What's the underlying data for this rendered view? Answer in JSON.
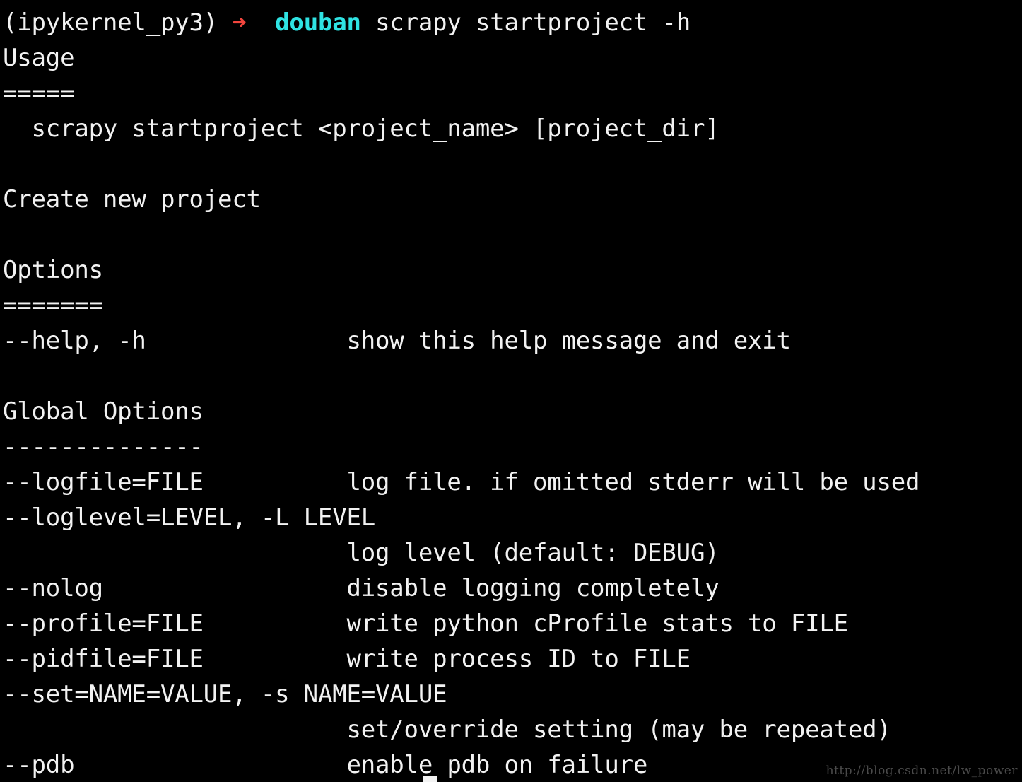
{
  "terminal": {
    "background": "#000000",
    "foreground": "#f2f2f2",
    "arrow_color": "#f2453d",
    "accent_color": "#2fe3e3",
    "watermark_color": "#4a4a4a"
  },
  "prompt": {
    "env": "(ipykernel_py3)",
    "arrow": "➜",
    "cwd": "douban",
    "command": "scrapy startproject -h"
  },
  "output": {
    "usage_heading": "Usage",
    "usage_rule": "=====",
    "usage_line": "  scrapy startproject <project_name> [project_dir]",
    "description": "Create new project",
    "options_heading": "Options",
    "options_rule": "=======",
    "options": [
      {
        "flag": "--help, -h",
        "desc": "show this help message and exit"
      }
    ],
    "global_options_heading": "Global Options",
    "global_options_rule": "--------------",
    "global_options": [
      {
        "flag": "--logfile=FILE",
        "desc": "log file. if omitted stderr will be used",
        "wrap": false
      },
      {
        "flag": "--loglevel=LEVEL, -L LEVEL",
        "desc": "log level (default: DEBUG)",
        "wrap": true
      },
      {
        "flag": "--nolog",
        "desc": "disable logging completely",
        "wrap": false
      },
      {
        "flag": "--profile=FILE",
        "desc": "write python cProfile stats to FILE",
        "wrap": false
      },
      {
        "flag": "--pidfile=FILE",
        "desc": "write process ID to FILE",
        "wrap": false
      },
      {
        "flag": "--set=NAME=VALUE, -s NAME=VALUE",
        "desc": "set/override setting (may be repeated)",
        "wrap": true
      },
      {
        "flag": "--pdb",
        "desc": "enable pdb on failure",
        "wrap": false
      }
    ]
  },
  "lines": {
    "l00": "(ipykernel_py3) ",
    "l01": "Usage",
    "l02": "=====",
    "l03": "  scrapy startproject <project_name> [project_dir]",
    "l04": "",
    "l05": "Create new project",
    "l06": "",
    "l07": "Options",
    "l08": "=======",
    "l09": "--help, -h              show this help message and exit",
    "l10": "",
    "l11": "Global Options",
    "l12": "--------------",
    "l13": "--logfile=FILE          log file. if omitted stderr will be used",
    "l14": "--loglevel=LEVEL, -L LEVEL",
    "l15": "                        log level (default: DEBUG)",
    "l16": "--nolog                 disable logging completely",
    "l17": "--profile=FILE          write python cProfile stats to FILE",
    "l18": "--pidfile=FILE          write process ID to FILE",
    "l19": "--set=NAME=VALUE, -s NAME=VALUE",
    "l20": "                        set/override setting (may be repeated)",
    "l21": "--pdb                   enable pdb on failure"
  },
  "watermark": {
    "text": "http://blog.csdn.net/lw_power"
  }
}
